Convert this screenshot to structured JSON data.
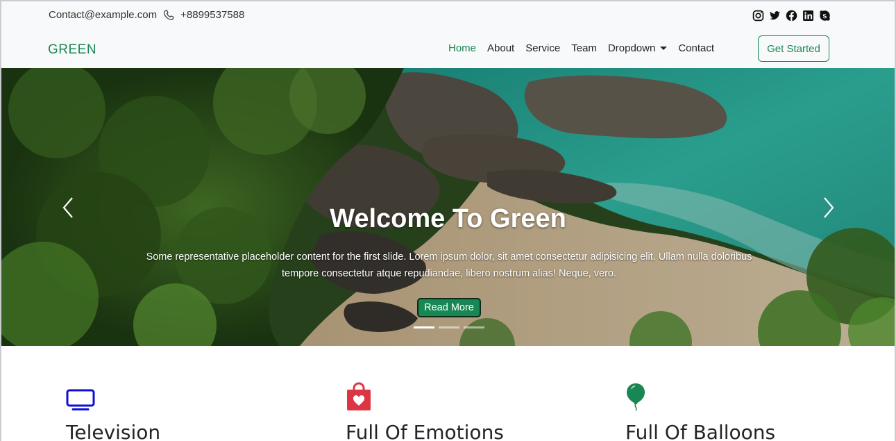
{
  "topbar": {
    "email": "Contact@example.com",
    "phone": "+8899537588",
    "socials": [
      "instagram-icon",
      "twitter-icon",
      "facebook-icon",
      "linkedin-icon",
      "skype-icon"
    ]
  },
  "navbar": {
    "brand": "GREEN",
    "links": [
      "Home",
      "About",
      "Service",
      "Team",
      "Dropdown",
      "Contact"
    ],
    "active": "Home",
    "cta": "Get Started"
  },
  "hero": {
    "title": "Welcome To Green",
    "description": "Some representative placeholder content for the first slide. Lorem ipsum dolor, sit amet consectetur adipisicing elit. Ullam nulla doloribus tempore consectetur atque repudiandae, libero nostrum alias! Neque, vero.",
    "button": "Read More",
    "slides_count": 3,
    "active_slide": 1
  },
  "features": [
    {
      "title": "Television",
      "icon": "tv-icon",
      "color": "#0d0dd6"
    },
    {
      "title": "Full Of Emotions",
      "icon": "bag-heart-icon",
      "color": "#dc3545"
    },
    {
      "title": "Full Of Balloons",
      "icon": "balloon-icon",
      "color": "#198754"
    }
  ],
  "colors": {
    "accent": "#198754",
    "topbar_bg": "#f8f9fa"
  }
}
